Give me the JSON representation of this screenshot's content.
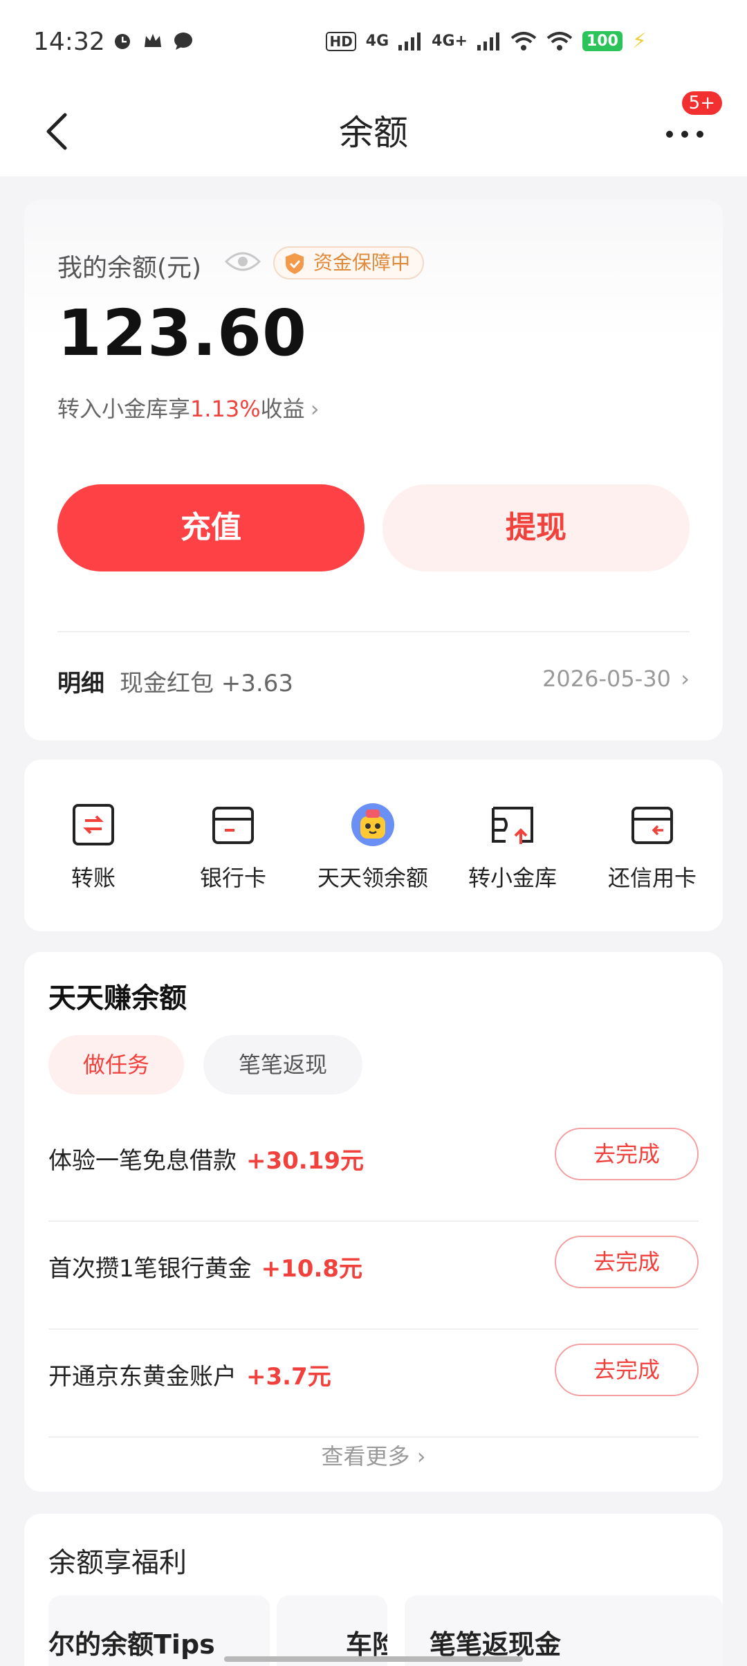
{
  "status_bar": {
    "time": "14:32",
    "left_icons": [
      "alarm-icon",
      "crown-icon",
      "chat-icon"
    ],
    "hd": "HD",
    "net1": "4G",
    "net2": "4G+",
    "battery": "100"
  },
  "nav": {
    "title": "余额",
    "badge": "5+"
  },
  "balance": {
    "label": "我的余额(元)",
    "guarantee": "资金保障中",
    "amount": "123.60",
    "transfer_prefix": "转入小金库享",
    "transfer_rate": "1.13%",
    "transfer_suffix": "收益",
    "recharge": "充值",
    "withdraw": "提现",
    "detail_label": "明细",
    "detail_desc": "现金红包 +3.63",
    "detail_date": "2026-05-30"
  },
  "actions": [
    {
      "label": "转账",
      "icon": "transfer-icon"
    },
    {
      "label": "银行卡",
      "icon": "bank-card-icon"
    },
    {
      "label": "天天领余额",
      "icon": "mascot-icon"
    },
    {
      "label": "转小金库",
      "icon": "vault-icon"
    },
    {
      "label": "还信用卡",
      "icon": "credit-card-icon"
    }
  ],
  "earn": {
    "title": "天天赚余额",
    "tabs": [
      "做任务",
      "笔笔返现"
    ],
    "tasks": [
      {
        "name": "体验一笔免息借款",
        "reward": "+30.19元",
        "button": "去完成"
      },
      {
        "name": "首次攒1笔银行黄金",
        "reward": "+10.8元",
        "button": "去完成"
      },
      {
        "name": "开通京东黄金账户",
        "reward": "+3.7元",
        "button": "去完成"
      }
    ],
    "see_more": "查看更多"
  },
  "benefits": {
    "title": "余额享福利",
    "items": [
      "尔的余额Tips",
      "车险",
      "笔笔返现金"
    ]
  }
}
